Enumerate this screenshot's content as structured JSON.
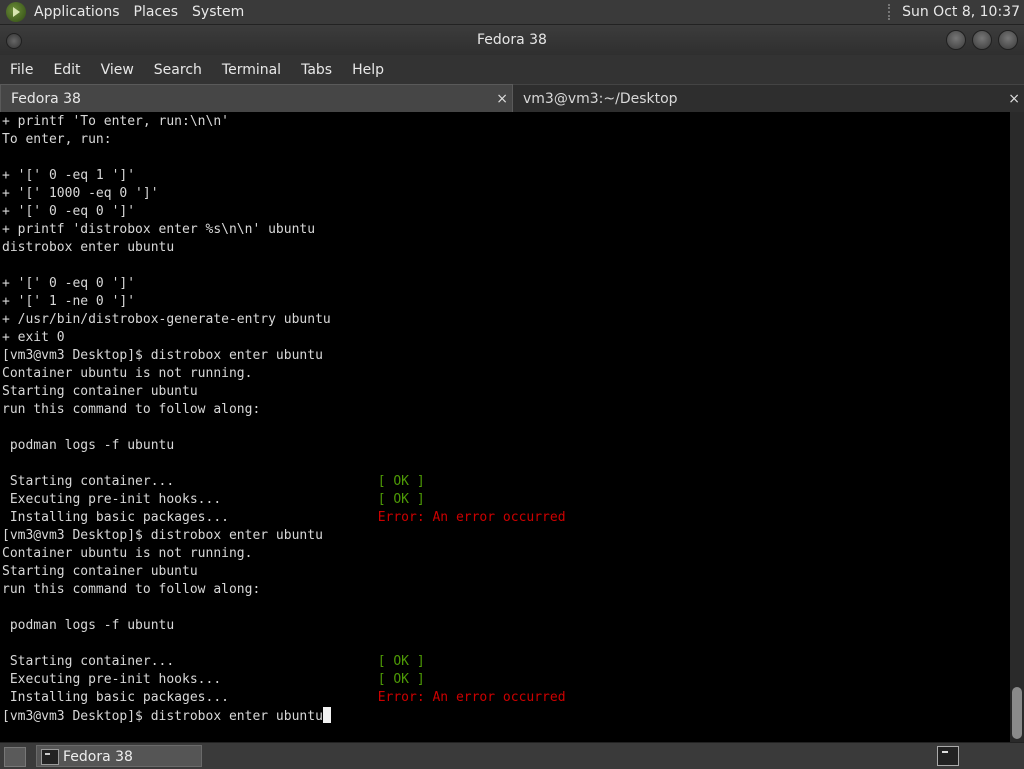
{
  "top_panel": {
    "menus": [
      "Applications",
      "Places",
      "System"
    ],
    "clock": "Sun Oct  8, 10:37"
  },
  "window": {
    "title": "Fedora 38"
  },
  "menubar": [
    "File",
    "Edit",
    "View",
    "Search",
    "Terminal",
    "Tabs",
    "Help"
  ],
  "tabs": [
    {
      "label": "Fedora 38",
      "close": "×"
    },
    {
      "label": "vm3@vm3:~/Desktop",
      "close": "×"
    }
  ],
  "terminal": {
    "lines": [
      "+ printf 'To enter, run:\\n\\n'",
      "To enter, run:",
      "",
      "+ '[' 0 -eq 1 ']'",
      "+ '[' 1000 -eq 0 ']'",
      "+ '[' 0 -eq 0 ']'",
      "+ printf 'distrobox enter %s\\n\\n' ubuntu",
      "distrobox enter ubuntu",
      "",
      "+ '[' 0 -eq 0 ']'",
      "+ '[' 1 -ne 0 ']'",
      "+ /usr/bin/distrobox-generate-entry ubuntu",
      "+ exit 0",
      "[vm3@vm3 Desktop]$ distrobox enter ubuntu",
      "Container ubuntu is not running.",
      "Starting container ubuntu",
      "run this command to follow along:",
      "",
      " podman logs -f ubuntu",
      "",
      [
        " Starting container...                          ",
        "[ OK ]",
        "ok"
      ],
      [
        " Executing pre-init hooks...                    ",
        "[ OK ]",
        "ok"
      ],
      [
        " Installing basic packages...                   ",
        "Error: An error occurred",
        "err"
      ],
      "[vm3@vm3 Desktop]$ distrobox enter ubuntu",
      "Container ubuntu is not running.",
      "Starting container ubuntu",
      "run this command to follow along:",
      "",
      " podman logs -f ubuntu",
      "",
      [
        " Starting container...                          ",
        "[ OK ]",
        "ok"
      ],
      [
        " Executing pre-init hooks...                    ",
        "[ OK ]",
        "ok"
      ],
      [
        " Installing basic packages...                   ",
        "Error: An error occurred",
        "err"
      ]
    ],
    "prompt_line": "[vm3@vm3 Desktop]$ distrobox enter ubuntu"
  },
  "taskbar": {
    "task_label": "Fedora 38"
  },
  "colors": {
    "ok": "#4e9a06",
    "error": "#cc0000",
    "background": "#000000"
  }
}
